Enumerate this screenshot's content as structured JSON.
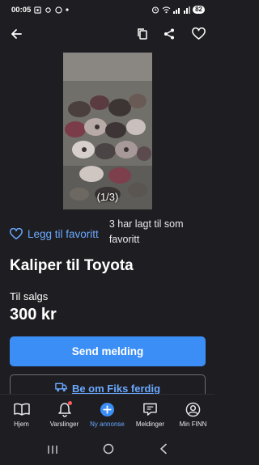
{
  "status_bar": {
    "time": "00:05",
    "battery": "82"
  },
  "photo": {
    "counter": "(1/3)"
  },
  "favorite": {
    "link_label": "Legg til favoritt",
    "count_text": "3 har lagt til som favoritt"
  },
  "listing": {
    "title": "Kaliper til Toyota",
    "sale_type": "Til salgs",
    "price": "300 kr"
  },
  "actions": {
    "send_message": "Send melding",
    "fiks_ferdig": "Be om Fiks ferdig"
  },
  "bottom_nav": {
    "items": [
      {
        "label": "Hjem",
        "icon": "book-icon"
      },
      {
        "label": "Varslinger",
        "icon": "bell-icon"
      },
      {
        "label": "Ny annonse",
        "icon": "plus-circle-icon"
      },
      {
        "label": "Meldinger",
        "icon": "chat-icon"
      },
      {
        "label": "Min FINN",
        "icon": "profile-icon"
      }
    ]
  },
  "colors": {
    "background": "#1e1e22",
    "accent": "#3b8ef5",
    "link": "#6aa8ff"
  }
}
